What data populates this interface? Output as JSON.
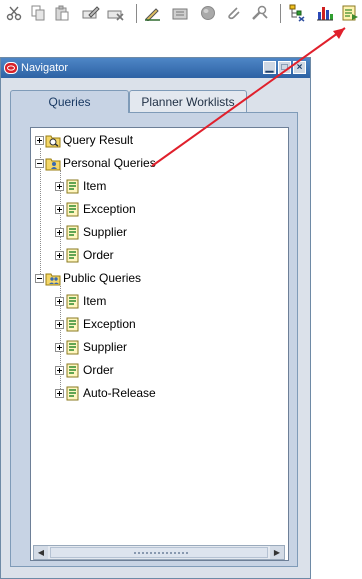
{
  "toolbar": {
    "buttons": [
      {
        "name": "cut-icon",
        "color": "#6a6a6a"
      },
      {
        "name": "copy-icon",
        "color": "#8a8a8a"
      },
      {
        "name": "paste-icon",
        "color": "#8a8a8a"
      },
      {
        "name": "edit-field-icon",
        "color": "#7a7a7a"
      },
      {
        "name": "clear-record-icon",
        "color": "#7a7a7a"
      },
      {
        "name": "edit-pencil-icon",
        "color": "#2f6a2f"
      },
      {
        "name": "folder-tools-icon",
        "color": "#8a8a8a"
      },
      {
        "name": "globe-icon",
        "color": "#8a8a8a"
      },
      {
        "name": "attachment-icon",
        "color": "#8a8a8a"
      },
      {
        "name": "tools-icon",
        "color": "#8a8a8a"
      },
      {
        "name": "hierarchy-icon",
        "color": "#2f4f9f"
      },
      {
        "name": "bar-chart-icon",
        "color": "#2b49b7"
      },
      {
        "name": "navigator-launch-icon",
        "color": "#3f8a2f"
      }
    ]
  },
  "window": {
    "title": "Navigator",
    "accent": "#3a70b5"
  },
  "tabs": [
    {
      "label": "Queries",
      "active": true
    },
    {
      "label": "Planner Worklists",
      "active": false
    }
  ],
  "tree": {
    "query_result": "Query Result",
    "personal": {
      "label": "Personal Queries",
      "children": [
        "Item",
        "Exception",
        "Supplier",
        "Order"
      ]
    },
    "public": {
      "label": "Public Queries",
      "children": [
        "Item",
        "Exception",
        "Supplier",
        "Order",
        "Auto-Release"
      ]
    }
  },
  "annotation_color": "#e0202c"
}
